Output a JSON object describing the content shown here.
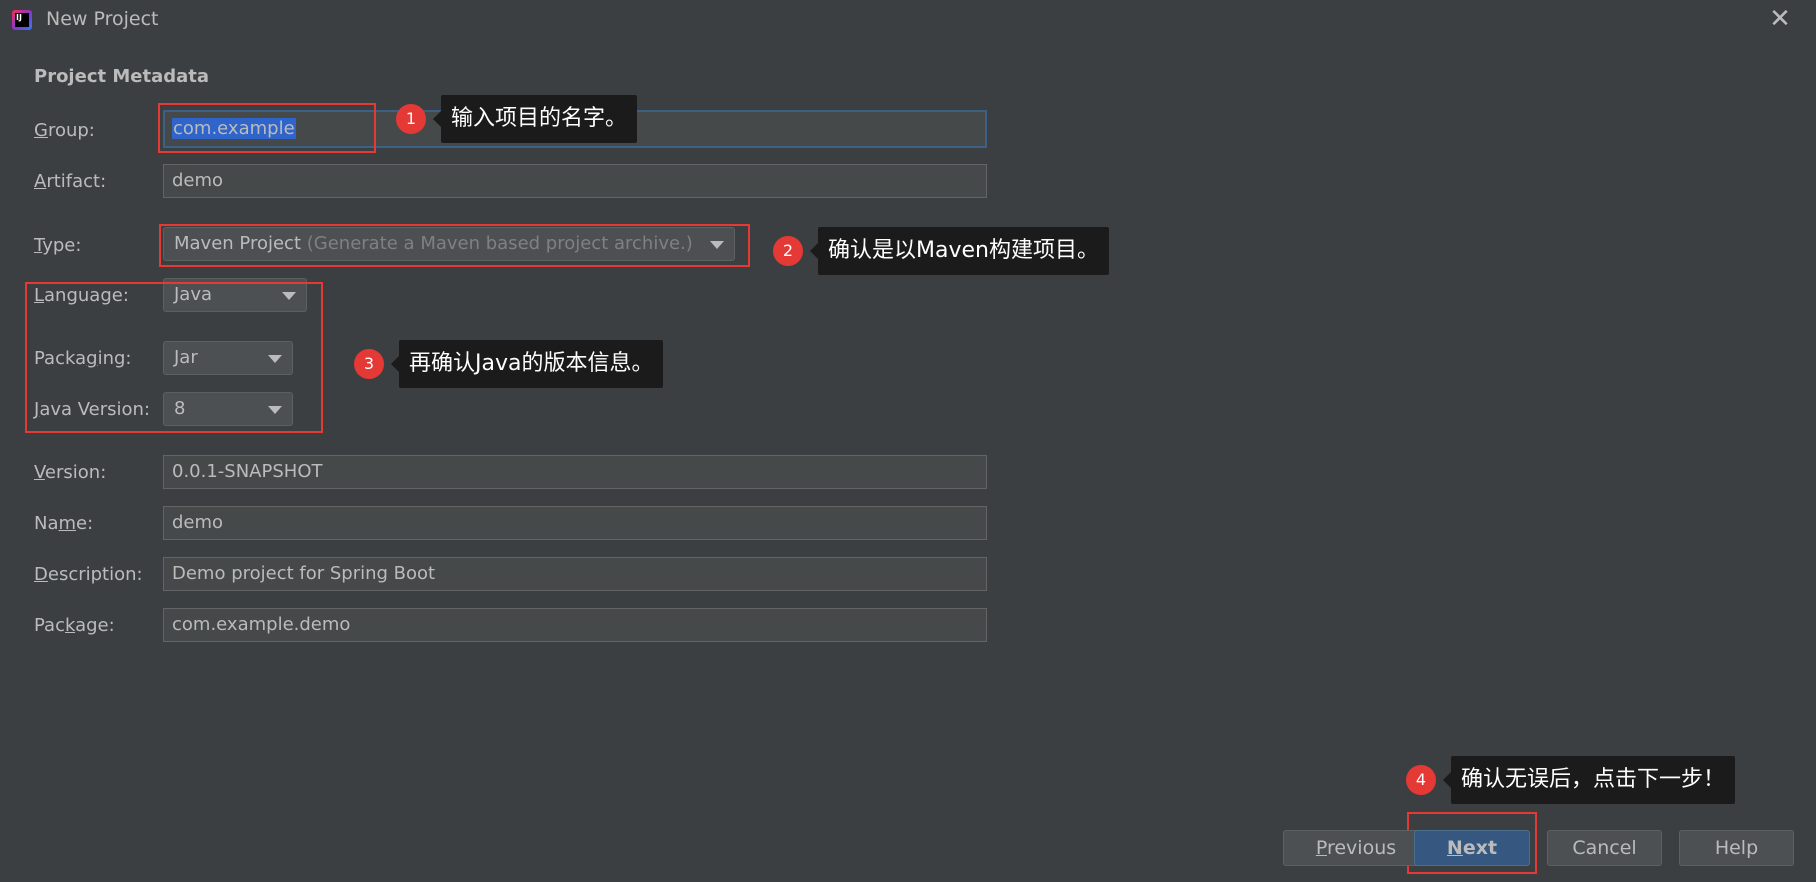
{
  "window": {
    "title": "New Project",
    "app_icon_text": "IJ"
  },
  "section_title": "Project Metadata",
  "fields": {
    "group": {
      "label_mn": "G",
      "label_rest": "roup:",
      "value": "com.example"
    },
    "artifact": {
      "label_mn": "A",
      "label_rest": "rtifact:",
      "value": "demo"
    },
    "type": {
      "label_mn": "T",
      "label_rest": "ype:",
      "value": "Maven Project",
      "hint": "(Generate a Maven based project archive.)"
    },
    "language": {
      "label_mn": "L",
      "label_rest": "anguage:",
      "value": "Java"
    },
    "packaging": {
      "label_pre": "Packa",
      "label_mn": "g",
      "label_rest": "ing:",
      "value": "Jar"
    },
    "java_version": {
      "label_mn": "J",
      "label_rest": "ava Version:",
      "value": "8"
    },
    "version": {
      "label_mn": "V",
      "label_rest": "ersion:",
      "value": "0.0.1-SNAPSHOT"
    },
    "name": {
      "label_pre": "Na",
      "label_mn": "m",
      "label_rest": "e:",
      "value": "demo"
    },
    "description": {
      "label_mn": "D",
      "label_rest": "escription:",
      "value": "Demo project for Spring Boot"
    },
    "package": {
      "label_pre": "Pac",
      "label_mn": "k",
      "label_rest": "age:",
      "value": "com.example.demo"
    }
  },
  "annotations": [
    {
      "number": "1",
      "text": "输入项目的名字。"
    },
    {
      "number": "2",
      "text": "确认是以Maven构建项目。"
    },
    {
      "number": "3",
      "text": "再确认Java的版本信息。"
    },
    {
      "number": "4",
      "text": "确认无误后，点击下一步！"
    }
  ],
  "buttons": {
    "previous": {
      "mn": "P",
      "rest": "revious"
    },
    "next": {
      "mn": "N",
      "rest": "ext"
    },
    "cancel": "Cancel",
    "help": "Help"
  },
  "colors": {
    "background": "#3c3f41",
    "field_bg": "#45494a",
    "selection": "#2f65ca",
    "primary_button": "#365880",
    "annotation_red": "#e53935",
    "tooltip_bg": "#1b1b1b"
  },
  "icons": {
    "close": "close-icon",
    "dropdown": "chevron-down-icon"
  }
}
